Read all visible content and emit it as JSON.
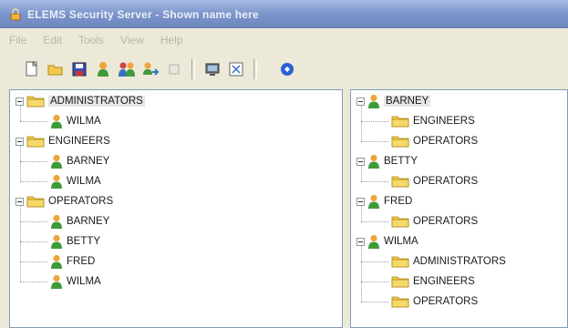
{
  "window": {
    "title": "ELEMS Security Server - Shown name here"
  },
  "menu": [
    "File",
    "Edit",
    "Tools",
    "View",
    "Help"
  ],
  "toolbar": {
    "buttons": [
      "new-icon",
      "open-icon",
      "save-icon",
      "add-user-icon",
      "add-group-icon",
      "assign-icon",
      "remove-icon",
      "computer-icon",
      "properties-icon",
      "help-icon"
    ]
  },
  "left_tree": {
    "groups": [
      {
        "name": "ADMINISTRATORS",
        "members": [
          "WILMA"
        ]
      },
      {
        "name": "ENGINEERS",
        "members": [
          "BARNEY",
          "WILMA"
        ]
      },
      {
        "name": "OPERATORS",
        "members": [
          "BARNEY",
          "BETTY",
          "FRED",
          "WILMA"
        ]
      }
    ]
  },
  "right_tree": {
    "users": [
      {
        "name": "BARNEY",
        "groups": [
          "ENGINEERS",
          "OPERATORS"
        ]
      },
      {
        "name": "BETTY",
        "groups": [
          "OPERATORS"
        ]
      },
      {
        "name": "FRED",
        "groups": [
          "OPERATORS"
        ]
      },
      {
        "name": "WILMA",
        "groups": [
          "ADMINISTRATORS",
          "ENGINEERS",
          "OPERATORS"
        ]
      }
    ]
  },
  "colors": {
    "folder": "#f2c94c",
    "user_head": "#f0a33a",
    "user_body": "#3f9a3a",
    "titlebar": "#7e97cd"
  }
}
